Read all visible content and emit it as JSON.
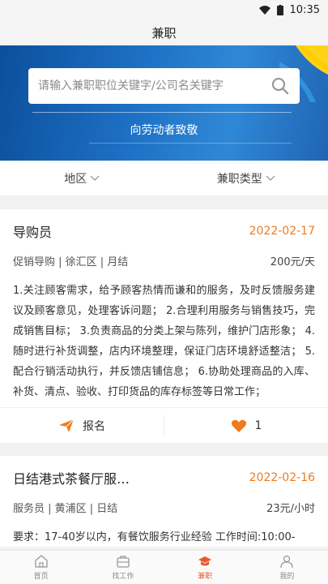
{
  "status": {
    "time": "10:35"
  },
  "header": {
    "title": "兼职"
  },
  "banner": {
    "search_placeholder": "请输入兼职职位关键字/公司名关键字",
    "slogan": "向劳动者致敬"
  },
  "filters": [
    {
      "label": "地区"
    },
    {
      "label": "兼职类型"
    }
  ],
  "jobs": [
    {
      "title": "导购员",
      "date": "2022-02-17",
      "meta": "促销导购 | 徐汇区 | 月结",
      "pay": "200元/天",
      "desc": "1.关注顾客需求，给予顾客热情而谦和的服务，及时反馈服务建议及顾客意见，处理客诉问题； 2.合理利用服务与销售技巧，完成销售目标； 3.负责商品的分类上架与陈列，维护门店形象； 4.随时进行补货调整，店内环境整理，保证门店环境舒适整洁； 5.配合行销活动执行，并反馈店铺信息； 6.协助处理商品的入库、补货、清点、验收、打印货品的库存标签等日常工作；",
      "apply_label": "报名",
      "likes": "1"
    },
    {
      "title": "日结港式茶餐厅服…",
      "date": "2022-02-16",
      "meta": "服务员 | 黄浦区 | 日结",
      "pay": "23元/小时",
      "desc": "要求：17-40岁以内，有餐饮服务行业经验 工作时间:10:00-"
    }
  ],
  "tabs": [
    {
      "label": "首页",
      "icon": "home-icon"
    },
    {
      "label": "找工作",
      "icon": "briefcase-icon"
    },
    {
      "label": "兼职",
      "icon": "graduation-cap-icon"
    },
    {
      "label": "我的",
      "icon": "user-icon"
    }
  ],
  "colors": {
    "accent": "#f07a1c",
    "active_tab": "#e85a2c",
    "banner": "#1d6fc4"
  }
}
